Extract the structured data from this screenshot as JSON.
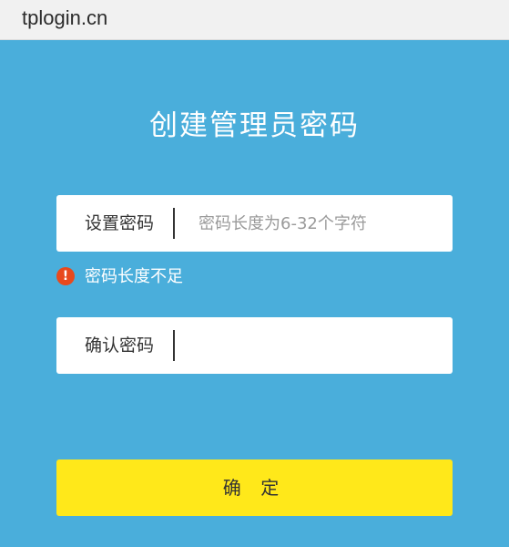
{
  "browser": {
    "address": "tplogin.cn"
  },
  "page": {
    "title": "创建管理员密码",
    "password_field": {
      "label": "设置密码",
      "value": "",
      "placeholder": "密码长度为6-32个字符"
    },
    "error": {
      "icon": "exclamation-icon",
      "message": "密码长度不足"
    },
    "confirm_field": {
      "label": "确认密码",
      "value": "",
      "placeholder": ""
    },
    "confirm_button": "确 定"
  },
  "colors": {
    "background": "#4aaedb",
    "button": "#ffe81a",
    "error_icon": "#e8491d"
  }
}
